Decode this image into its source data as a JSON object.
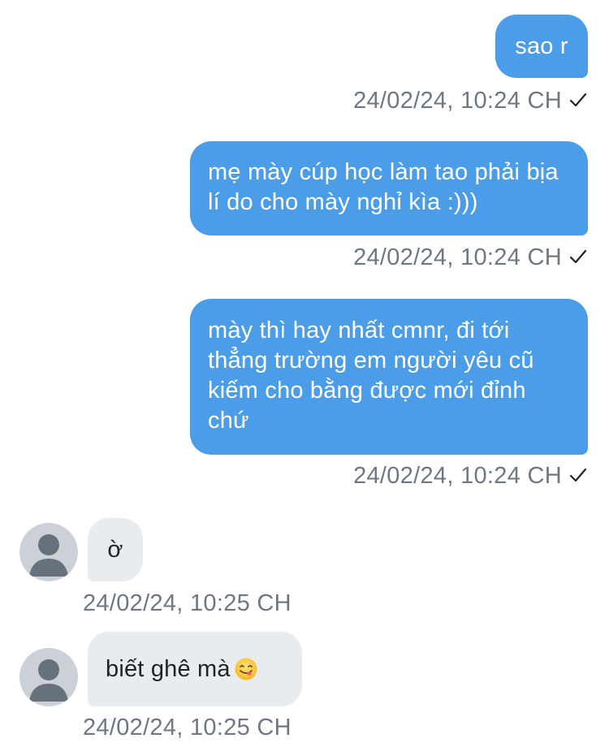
{
  "messages": [
    {
      "direction": "outgoing",
      "text": "sao r",
      "timestamp": "24/02/24, 10:24 CH",
      "status_icon": "check-icon"
    },
    {
      "direction": "outgoing",
      "text": "mẹ mày cúp học làm tao phải bịa lí do cho mày nghỉ kìa :)))",
      "timestamp": "24/02/24, 10:24 CH",
      "status_icon": "check-icon"
    },
    {
      "direction": "outgoing",
      "text": "mày thì hay nhất cmnr, đi tới thẳng trường em người yêu cũ kiếm cho bằng được mới đỉnh chứ",
      "timestamp": "24/02/24, 10:24 CH",
      "status_icon": "check-icon"
    },
    {
      "direction": "incoming",
      "text": "ờ",
      "timestamp": "24/02/24, 10:25 CH",
      "avatar_icon": "user-avatar-icon"
    },
    {
      "direction": "incoming",
      "text": "biết ghê mà",
      "emoji": "smiling-face-savoring-food-emoji",
      "timestamp": "24/02/24, 10:25 CH",
      "avatar_icon": "user-avatar-icon"
    }
  ],
  "colors": {
    "outgoing_bubble": "#4c9de8",
    "incoming_bubble": "#e9ecef",
    "timestamp_text": "#6e7782",
    "avatar_bg": "#ccd1d7",
    "avatar_fg": "#67717c"
  }
}
